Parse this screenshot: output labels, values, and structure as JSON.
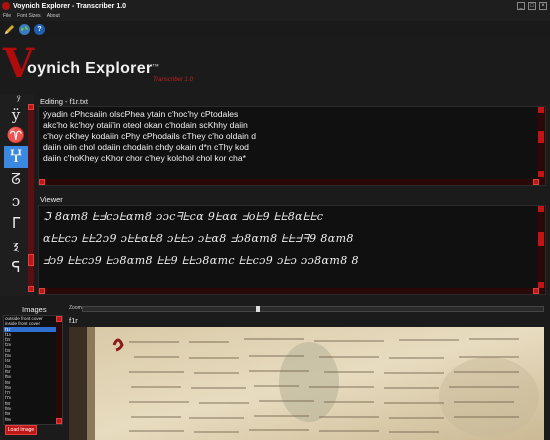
{
  "window": {
    "title": "Voynich Explorer - Transcriber 1.0",
    "controls": [
      "_",
      "□",
      "×"
    ]
  },
  "menu": [
    "File",
    "Font Sizes",
    "About"
  ],
  "toolbar": {
    "icons": [
      "pencil-icon",
      "globe-icon",
      "help-icon"
    ],
    "help_glyph": "?"
  },
  "logo": {
    "initial": "V",
    "text": "oynich Explorer",
    "tm": "TM",
    "sub": "Transcriber 1.0"
  },
  "sidebar": {
    "top_glyph": "ÿ",
    "glyphs": [
      "ÿ",
      "♈",
      "Ⴤ",
      "ᘔ",
      "ɔ",
      "ᒥ",
      "ⲝ",
      "ᕋ"
    ],
    "selected_index": 2
  },
  "editor": {
    "label": "Editing - f1r.txt",
    "lines": [
      "ýyadin cPhcsaiin olscPhea ytain c'hoc'hy cPtodales",
      "akc'ho kc'hoy otaii'in oteol okan c'hodain scKhhy daiin",
      "c'hoy cKhey kodaiin cPhy cPhodails cThey c'ho oldain d",
      "daiin oiin chol odaiin chodain chdy okain d*n cThy kod",
      "daiin c'hoKhey cKhor chor c'hey kolchol chol kor cha*"
    ]
  },
  "viewer": {
    "label": "Viewer",
    "lines": [
      "ℑ 8ɑm8 ᖶᖵcɔᖶɑm8 ɔɔcᖷᖶcɑ 9ᖶɑɑ ᖵoᖶ9 ᖶᖶ8ɑᖶᖶc",
      "ɑᖶᖶcɔ ᖶᖶ2ɔ9 ɔᖶᖶɑᖶ8 ɔᖶᖶɔ ɔᖶɑ8 ᖵɔ8ɑm8 ᖶᖶᖵᖷ9 8ɑm8",
      "ᖵɔ9 ᖶᖶcɔ9 ᖶɔ8ɑm8 ᖶᖶ9 ᖶᖶɔ8ɑmc ᖶᖶcɔ9 ɔᖶɔ ɔɔ8ɑm8 8"
    ]
  },
  "images": {
    "label": "Images",
    "items": [
      "outside front cover",
      "inside front cover",
      "f1r",
      "f1v",
      "f2r",
      "f2v",
      "f3r",
      "f3v",
      "f4r",
      "f4v",
      "f5r",
      "f5v",
      "f6r",
      "f6v",
      "f7r",
      "f7v",
      "f8r",
      "f8v",
      "f9r",
      "f9v"
    ],
    "selected_index": 2,
    "load_button": "Load Image"
  },
  "zoom": {
    "label": "Zoom",
    "level": 0.38
  },
  "image_view": {
    "filename": "f1r"
  },
  "colors": {
    "accent_red": "#c01515",
    "select_blue": "#3a88e0",
    "background": "#1b1b1b"
  }
}
